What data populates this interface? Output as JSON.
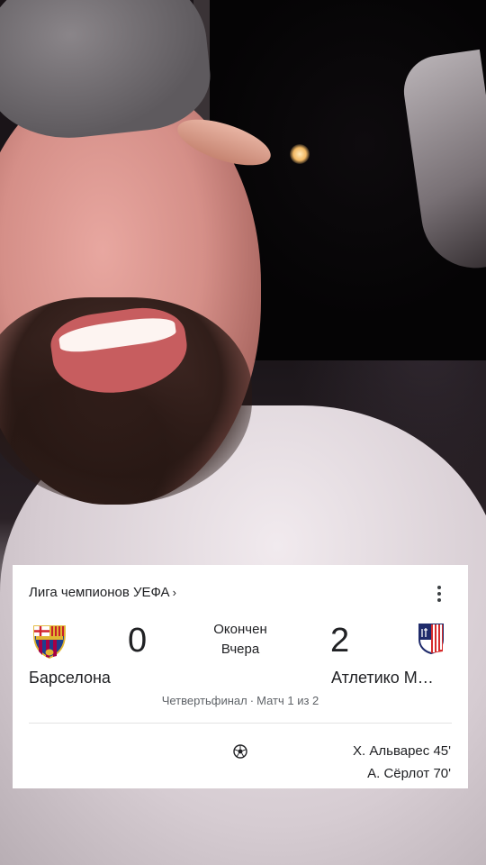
{
  "match_card": {
    "league": "Лига чемпионов УЕФА",
    "status": "Окончен",
    "date": "Вчера",
    "stage": "Четвертьфинал",
    "leg": "Матч 1 из 2",
    "home": {
      "name": "Барселона",
      "score": "0",
      "crest_icon": "fc-barcelona-crest-icon"
    },
    "away": {
      "name": "Атлетико М…",
      "score": "2",
      "crest_icon": "atletico-madrid-crest-icon"
    },
    "goals_icon": "soccer-ball-icon",
    "goals": [
      {
        "text": "Х. Альварес 45'"
      },
      {
        "text": "А. Сёрлот 70'"
      }
    ],
    "card_background": "#ffffff",
    "text_color": "#202124",
    "secondary_text_color": "#5f6368"
  }
}
